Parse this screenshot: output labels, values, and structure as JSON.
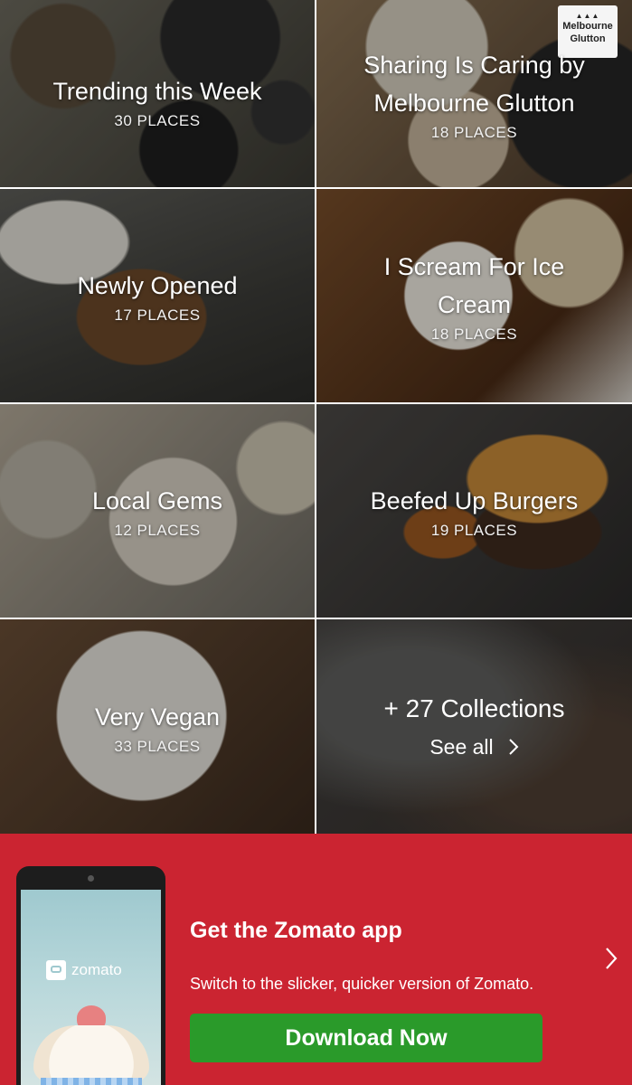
{
  "collections": [
    {
      "title": "Trending this Week",
      "count": "30 PLACES"
    },
    {
      "title": "Sharing Is Caring by Melbourne Glutton",
      "count": "18 PLACES",
      "badge": [
        "Melbourne",
        "Glutton"
      ]
    },
    {
      "title": "Newly Opened",
      "count": "17 PLACES"
    },
    {
      "title": "I Scream For Ice Cream",
      "count": "18 PLACES"
    },
    {
      "title": "Local Gems",
      "count": "12 PLACES"
    },
    {
      "title": "Beefed Up Burgers",
      "count": "19 PLACES"
    },
    {
      "title": "Very Vegan",
      "count": "33 PLACES"
    }
  ],
  "see_all": {
    "more_label": "+ 27 Collections",
    "link_label": "See all"
  },
  "promo": {
    "brand": "zomato",
    "title": "Get the Zomato app",
    "subtitle": "Switch to the slicker, quicker version of Zomato.",
    "button_label": "Download Now",
    "background_color": "#cb2431",
    "button_color": "#2a9a2a"
  },
  "icons": {
    "chevron": "chevron-right-icon",
    "brand": "zomato-logo-icon"
  }
}
